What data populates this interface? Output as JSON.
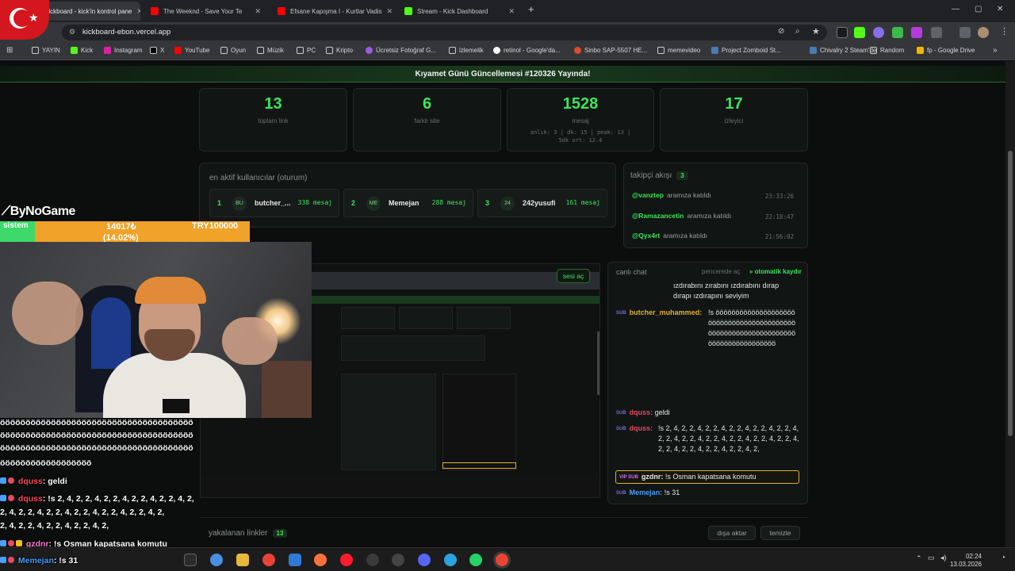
{
  "browser": {
    "tabs": [
      {
        "label": "Kickboard - kick'in kontrol pane",
        "active": true
      },
      {
        "label": "The Weeknd - Save Your Te",
        "active": false
      },
      {
        "label": "Efsane Kapışma I - Kurtlar Vadis",
        "active": false
      },
      {
        "label": "Stream - Kick Dashboard",
        "active": false
      }
    ],
    "url": "kickboard-ebon.vercel.app",
    "bookmarks": [
      "YAYIN",
      "Kick",
      "Instagram",
      "X",
      "YouTube",
      "Oyun",
      "Müzik",
      "PC",
      "Kripto",
      "Ücretsiz Fotoğraf G...",
      "izlemelik",
      "retinol - Google'da...",
      "Sinbo SAP-5507 HE...",
      "memevideo",
      "Project Zomboid St...",
      "Chivalry 2 Steam'de",
      "Random",
      "fp - Google Drive"
    ]
  },
  "banner": "Kıyamet Günü Güncellemesi #120326 Yayında!",
  "stats": [
    {
      "value": "13",
      "label": "toplam link",
      "sub": ""
    },
    {
      "value": "6",
      "label": "farklı site",
      "sub": ""
    },
    {
      "value": "1528",
      "label": "mesaj",
      "sub": "anlık: 3 | dk: 15 | peak: 13 | 5dk ort: 12.4"
    },
    {
      "value": "17",
      "label": "izleyici",
      "sub": ""
    }
  ],
  "active_users": {
    "title": "en aktif kullanıcılar (oturum)",
    "items": [
      {
        "rank": "1",
        "avatar": "BU",
        "name": "butcher_...",
        "count": "338 mesaj"
      },
      {
        "rank": "2",
        "avatar": "ME",
        "name": "Memejan",
        "count": "288 mesaj"
      },
      {
        "rank": "3",
        "avatar": "24",
        "name": "242yusufi",
        "count": "161 mesaj"
      }
    ]
  },
  "followers": {
    "title": "takipçi akışı",
    "count": "3",
    "items": [
      {
        "handle": "@vanztep",
        "text": "aramıza katıldı",
        "time": "23:33:26"
      },
      {
        "handle": "@Ramazancetin",
        "text": "aramıza katıldı",
        "time": "22:18:47"
      },
      {
        "handle": "@Qyx4rt",
        "text": "aramıza katıldı",
        "time": "21:56:02"
      }
    ]
  },
  "stream": {
    "sound_button": "sesi aç"
  },
  "live_chat": {
    "title": "canlı chat",
    "popout": "pencerede aç",
    "autoscroll": "otomatik kaydır",
    "cont_text": "ızdırabını zırabını ızdırabını dırap dırapı ızdırapını seviyim",
    "messages": [
      {
        "badge": "SUB",
        "user": "butcher_muhammed:",
        "text": "!s ööööööööööööööööööööööööööööööööööööööööööööööööööööööööööööööööööööööööööööööööö",
        "color": "#e0b03a"
      },
      {
        "badge": "SUB",
        "user": "dquss:",
        "text": "geldi",
        "color": "#e84a5f"
      },
      {
        "badge": "SUB",
        "user": "dquss:",
        "text": "!s 2, 4, 2, 2, 4, 2, 2, 4, 2, 2, 4, 2, 2, 4, 2, 2, 4, 2, 2, 4, 2, 2, 4, 2, 2, 4, 2, 2, 4, 2, 2, 4, 2, 2, 4, 2, 2, 4, 2, 2, 4, 2, 2, 4, 2, 2, 4, 2,",
        "color": "#e84a5f"
      },
      {
        "badge": "VIP SUB",
        "user": "gzdnr:",
        "text": "!s Osman kapatsana komutu",
        "color": "#e8e8e8",
        "highlight": true
      },
      {
        "badge": "SUB",
        "user": "Memejan:",
        "text": "!s 31",
        "color": "#4aa0ff"
      }
    ]
  },
  "links": {
    "title": "yakalanan linkler",
    "count": "13",
    "export": "dışa aktar",
    "clear": "temizle"
  },
  "overlay": {
    "brand": "ByNoGame",
    "goal": {
      "label": "sistem",
      "amount": "14017₺",
      "percent": "(14.02%)",
      "target": "TRY100000",
      "fraction": 0.1402
    },
    "chat": [
      {
        "user": "",
        "text": "öööööööööööööööööööööööööööööööööööööö"
      },
      {
        "user": "",
        "text": "öööööööööööööööööööööööööööööööööööööö"
      },
      {
        "user": "",
        "text": "öööööööööööööööööööööööööööööööööööööö"
      },
      {
        "user": "",
        "text": "öööööööööööööööööö"
      },
      {
        "user": "dquss",
        "text": ": geldi"
      },
      {
        "user": "dquss",
        "text": ": !s 2, 4, 2, 2, 4, 2, 2, 4, 2, 2, 4, 2, 2, 4, 2,"
      },
      {
        "user": "",
        "text": "2, 4, 2, 2, 4, 2, 2, 4, 2, 2, 4, 2, 2, 4, 2, 2, 4, 2,"
      },
      {
        "user": "",
        "text": "2, 4, 2, 2, 4, 2, 2, 4, 2, 2, 4, 2,"
      },
      {
        "user": "gzdnr",
        "text": ": !s Osman kapatsana komutu"
      },
      {
        "user": "Memejan",
        "text": ": !s 31"
      }
    ]
  },
  "taskbar": {
    "time": "02:24",
    "date": "13.03.2026"
  },
  "colors": {
    "accent": "#3de65a",
    "background": "#0b0e0d",
    "card": "#111514",
    "goal_orange": "#f0a229",
    "goal_green": "#3dd96a"
  }
}
